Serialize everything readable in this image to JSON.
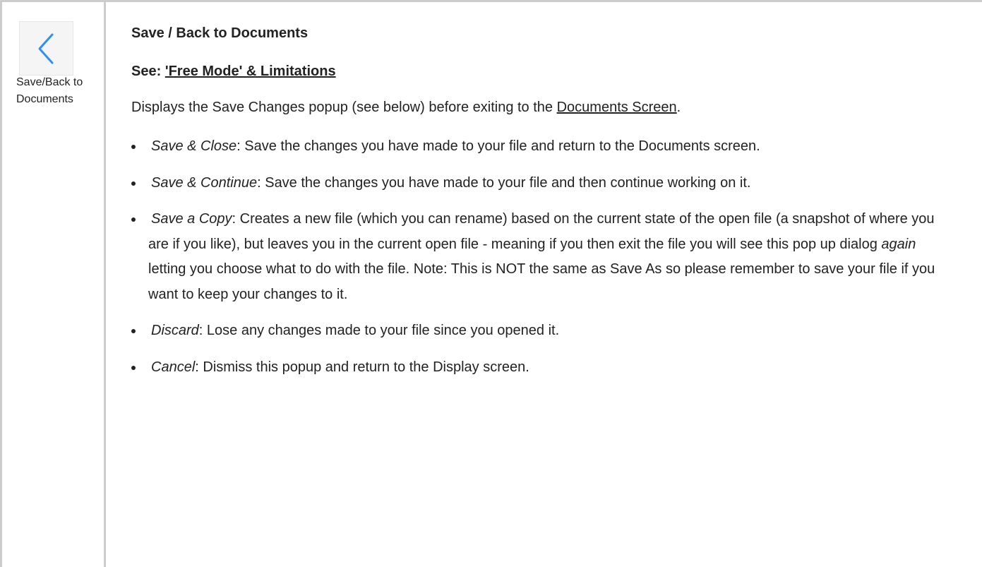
{
  "icon_cell": {
    "icon": "chevron-left-icon",
    "caption": "Save/Back to Documents",
    "accent_color": "#2f8ff7"
  },
  "heading": "Save / Back to Documents",
  "see_prefix": "See: ",
  "see_link": "'Free Mode' & Limitations",
  "intro": {
    "before": "Displays the Save Changes popup (see below) before exiting to the ",
    "link": "Documents Screen",
    "after": "."
  },
  "options": [
    {
      "term": "Save & Close",
      "text": ": Save the changes you have made to your file and return to the Documents screen."
    },
    {
      "term": "Save & Continue",
      "text": ": Save the changes you have made to your file and then continue working on it."
    },
    {
      "term": "Save a Copy",
      "text_before": ": Creates a new file (which you can rename) based on the current state of the open file (a snapshot of where you are if you like), but leaves you in the current open file - meaning if you then exit the file you will see this pop up dialog ",
      "emphasis": "again",
      "text_after": " letting you choose what to do with the file. Note: This is NOT the same as Save As so please remember to save your file if you want to keep your changes to it."
    },
    {
      "term": "Discard",
      "text": ": Lose any changes made to your file since you opened it."
    },
    {
      "term": "Cancel",
      "text": ": Dismiss this popup and return to the Display screen."
    }
  ]
}
